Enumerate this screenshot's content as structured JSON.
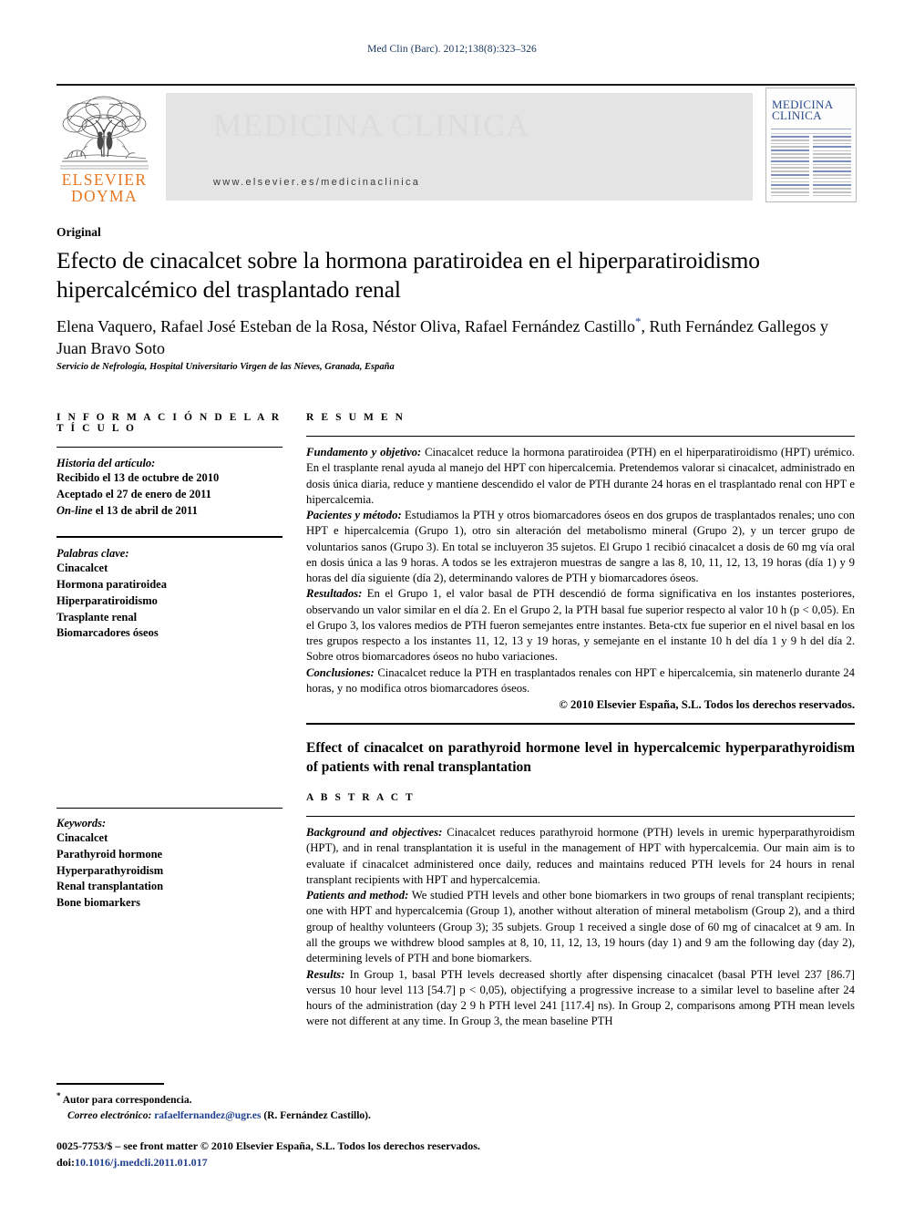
{
  "running_head": "Med Clin (Barc). 2012;138(8):323–326",
  "masthead": {
    "publisher_line1": "ELSEVIER",
    "publisher_line2": "DOYMA",
    "journal_name": "MEDICINA CLINICA",
    "url": "www.elsevier.es/medicinaclinica",
    "cover": {
      "title_line1": "MEDICINA",
      "title_line2": "CLINICA"
    }
  },
  "article": {
    "section": "Original",
    "title": "Efecto de cinacalcet sobre la hormona paratiroidea en el hiperparatiroidismo hipercalcémico del trasplantado renal",
    "authors": "Elena Vaquero, Rafael José Esteban de la Rosa, Néstor Oliva, Rafael Fernández Castillo",
    "authors_line2": ", Ruth Fernández Gallegos y Juan Bravo Soto",
    "affiliation": "Servicio de Nefrología, Hospital Universitario Virgen de las Nieves, Granada, España"
  },
  "info_panel": {
    "heading": "I N F O R M A C I Ó N   D E L   A R T Í C U L O",
    "history_label": "Historia del artículo:",
    "history": [
      "Recibido el 13 de octubre de 2010",
      "Aceptado el 27 de enero de 2011",
      "On-line el 13 de abril de 2011"
    ],
    "history_online_prefix": "On-line",
    "history_online_rest": " el 13 de abril de 2011",
    "keywords_label": "Palabras clave:",
    "keywords": [
      "Cinacalcet",
      "Hormona paratiroidea",
      "Hiperparatiroidismo",
      "Trasplante renal",
      "Biomarcadores óseos"
    ],
    "keywords_en_label": "Keywords:",
    "keywords_en": [
      "Cinacalcet",
      "Parathyroid hormone",
      "Hyperparathyroidism",
      "Renal transplantation",
      "Bone biomarkers"
    ]
  },
  "resumen": {
    "heading": "R E S U M E N",
    "paragraphs": [
      {
        "label": "Fundamento y objetivo:",
        "text": " Cinacalcet reduce la hormona paratiroidea (PTH) en el hiperparatiroidismo (HPT) urémico. En el trasplante renal ayuda al manejo del HPT con hipercalcemia. Pretendemos valorar si cinacalcet, administrado en dosis única diaria, reduce y mantiene descendido el valor de PTH durante 24 horas en el trasplantado renal con HPT e hipercalcemia."
      },
      {
        "label": "Pacientes y método:",
        "text": " Estudiamos la PTH y otros biomarcadores óseos en dos grupos de trasplantados renales; uno con HPT e hipercalcemia (Grupo 1), otro sin alteración del metabolismo mineral (Grupo 2), y un tercer grupo de voluntarios sanos (Grupo 3). En total se incluyeron 35 sujetos. El Grupo 1 recibió cinacalcet a dosis de 60 mg vía oral en dosis única a las 9 horas. A todos se les extrajeron muestras de sangre a las 8, 10, 11, 12, 13, 19 horas (día 1) y 9 horas del día siguiente (día 2), determinando valores de PTH y biomarcadores óseos."
      },
      {
        "label": "Resultados:",
        "text": " En el Grupo 1, el valor basal de PTH descendió de forma significativa en los instantes posteriores, observando un valor similar en el día 2. En el Grupo 2, la PTH basal fue superior respecto al valor 10 h (p < 0,05). En el Grupo 3, los valores medios de PTH fueron semejantes entre instantes. Beta-ctx fue superior en el nivel basal en los tres grupos respecto a los instantes 11, 12, 13 y 19 horas, y semejante en el instante 10 h del día 1 y 9 h del día 2. Sobre otros biomarcadores óseos no hubo variaciones."
      },
      {
        "label": "Conclusiones:",
        "text": " Cinacalcet reduce la PTH en trasplantados renales con HPT e hipercalcemia, sin matenerlo durante 24 horas, y no modifica otros biomarcadores óseos."
      }
    ],
    "copyright": "© 2010 Elsevier España, S.L. Todos los derechos reservados."
  },
  "abstract": {
    "title": "Effect of cinacalcet on parathyroid hormone level in hypercalcemic hyperparathyroidism of patients with renal transplantation",
    "heading": "A B S T R A C T",
    "paragraphs": [
      {
        "label": "Background and objectives:",
        "text": " Cinacalcet reduces parathyroid hormone (PTH) levels in uremic hyperparathyroidism (HPT), and in renal transplantation it is useful in the management of HPT with hypercalcemia. Our main aim is to evaluate if cinacalcet administered once daily, reduces and maintains reduced PTH levels for 24 hours in renal transplant recipients with HPT and hypercalcemia."
      },
      {
        "label": "Patients and method:",
        "text": " We studied PTH levels and other bone biomarkers in two groups of renal transplant recipients; one with HPT and hypercalcemia (Group 1), another without alteration of mineral metabolism (Group 2), and a third group of healthy volunteers (Group 3); 35 subjets. Group 1 received a single dose of 60 mg of cinacalcet at 9 am. In all the groups we withdrew blood samples at 8, 10, 11, 12, 13, 19 hours (day 1) and 9 am the following day (day 2), determining levels of PTH and bone biomarkers."
      },
      {
        "label": "Results:",
        "text": " In Group 1, basal PTH levels decreased shortly after dispensing cinacalcet (basal PTH level 237 [86.7] versus 10 hour level 113 [54.7] p < 0,05), objectifying a progressive increase to a similar level to baseline after 24 hours of the administration (day 2 9 h PTH level 241 [117.4] ns). In Group 2, comparisons among PTH mean levels were not different at any time. In Group 3, the mean baseline PTH"
      }
    ]
  },
  "footer": {
    "corresponding_label": "Autor para correspondencia.",
    "email_label": "Correo electrónico:",
    "email": "rafaelfernandez@ugr.es",
    "email_owner": " (R. Fernández Castillo).",
    "issn_line": "0025-7753/$ – see front matter © 2010 Elsevier España, S.L. Todos los derechos reservados.",
    "doi_label": "doi:",
    "doi": "10.1016/j.medcli.2011.01.017"
  }
}
